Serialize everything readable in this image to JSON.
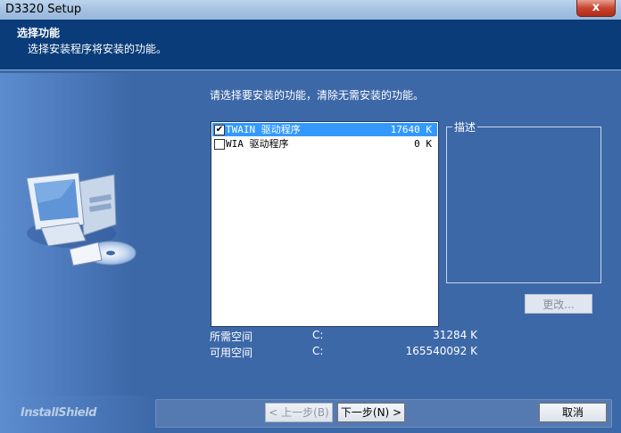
{
  "window": {
    "title": "D3320 Setup",
    "close_glyph": "x"
  },
  "header": {
    "title": "选择功能",
    "subtitle": "选择安装程序将安装的功能。"
  },
  "main": {
    "prompt": "请选择要安装的功能，清除无需安装的功能。",
    "features": [
      {
        "name": "TWAIN 驱动程序",
        "size": "17640 K",
        "checked": true,
        "selected": true
      },
      {
        "name": "WIA 驱动程序",
        "size": "0 K",
        "checked": false,
        "selected": false
      }
    ],
    "description": {
      "label": "描述"
    },
    "change_button": "更改...",
    "space": [
      {
        "label": "所需空间",
        "drive": "C:",
        "value": "31284 K"
      },
      {
        "label": "可用空间",
        "drive": "C:",
        "value": "165540092 K"
      }
    ]
  },
  "footer": {
    "logo": "InstallShield",
    "back_button": "< 上一步(B)",
    "next_button": "下一步(N) >",
    "cancel_button": "取消"
  },
  "colors": {
    "panel_blue": "#3d68a8",
    "header_navy": "#0a3c79",
    "selection": "#3399ff"
  }
}
